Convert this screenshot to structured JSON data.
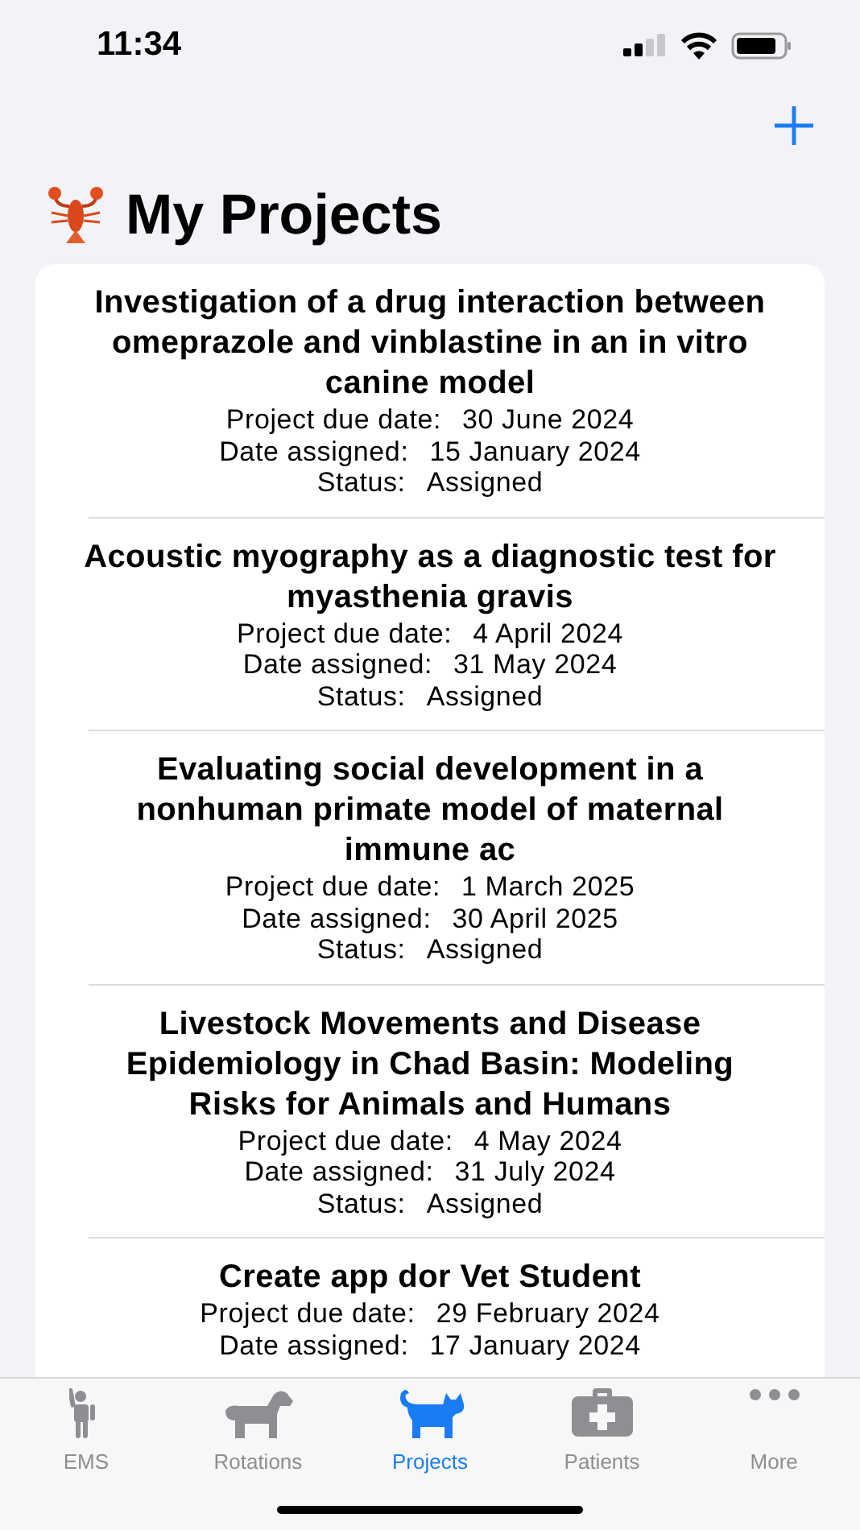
{
  "status_bar": {
    "time": "11:34"
  },
  "nav": {
    "title": "My Projects"
  },
  "projects": [
    {
      "title": "Investigation of a drug interaction between omeprazole and vinblastine in an in vitro canine model",
      "due_label": "Project due date:",
      "due": "30 June 2024",
      "assigned_label": "Date assigned:",
      "assigned": "15 January 2024",
      "status_label": "Status:",
      "status": "Assigned"
    },
    {
      "title": "Acoustic myography as a diagnostic test for\nmyasthenia gravis",
      "due_label": "Project due date:",
      "due": "4 April 2024",
      "assigned_label": "Date assigned:",
      "assigned": "31 May 2024",
      "status_label": "Status:",
      "status": "Assigned"
    },
    {
      "title": "Evaluating social development in a nonhuman primate model of maternal immune ac",
      "due_label": "Project due date:",
      "due": "1 March 2025",
      "assigned_label": "Date assigned:",
      "assigned": "30 April 2025",
      "status_label": "Status:",
      "status": "Assigned"
    },
    {
      "title": "Livestock Movements and Disease Epidemiology in Chad Basin: Modeling Risks for Animals and Humans",
      "due_label": "Project due date:",
      "due": "4 May 2024",
      "assigned_label": "Date assigned:",
      "assigned": "31 July 2024",
      "status_label": "Status:",
      "status": "Assigned"
    },
    {
      "title": "Create app dor Vet Student",
      "due_label": "Project due date:",
      "due": "29 February 2024",
      "assigned_label": "Date assigned:",
      "assigned": "17 January 2024"
    }
  ],
  "tabs": [
    {
      "label": "EMS",
      "kind": "person",
      "selected": false
    },
    {
      "label": "Rotations",
      "kind": "dog",
      "selected": false
    },
    {
      "label": "Projects",
      "kind": "cat",
      "selected": true
    },
    {
      "label": "Patients",
      "kind": "medkit",
      "selected": false
    },
    {
      "label": "More",
      "kind": "more",
      "selected": false
    }
  ]
}
